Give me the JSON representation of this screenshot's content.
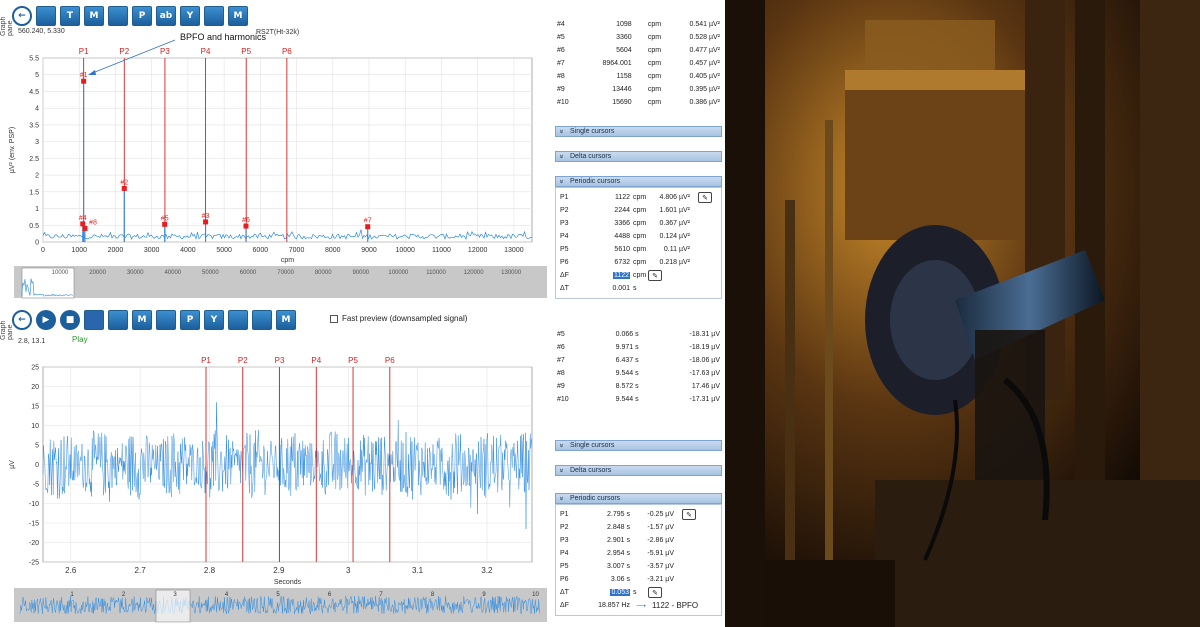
{
  "colors": {
    "accent": "#1c5f9c",
    "signal": "#2f8ce0",
    "cursor_line": "#d62020",
    "marker": "#e81e1e",
    "panel_header": "#b6cde9"
  },
  "top": {
    "graph_pane_label": "Graph pane",
    "coords": "560.240, 5.330",
    "toolbar_icons": [
      "back-arrow-icon",
      "export-icon",
      "trend-icon",
      "marker-icon",
      "harmonic-icon",
      "peak-icon",
      "ab-label-icon",
      "y-scale-icon",
      "zoom-box-icon",
      "overlay-marker-icon"
    ],
    "toolbar_labels": [
      "",
      "",
      "T",
      "M",
      "",
      "P",
      "ab",
      "Y",
      "",
      "M"
    ],
    "annotation": "BPFO and harmonics",
    "chart_title": "RS2T(Ht-32k)"
  },
  "bottom": {
    "graph_pane_label": "Graph pane",
    "coords": "2.8, 13.1",
    "toolbar_icons": [
      "back-arrow-icon",
      "play-icon",
      "stop-icon",
      "save-icon",
      "spectrum-icon",
      "marker-icon",
      "harmonic-icon",
      "peak-icon",
      "y-scale-icon",
      "eraser-icon",
      "zoom-box-icon",
      "overlay-marker-icon"
    ],
    "toolbar_labels": [
      "",
      "▶",
      "■",
      "",
      "",
      "M",
      "",
      "P",
      "Y",
      "",
      "",
      "M"
    ],
    "play_label": "Play",
    "fast_preview_label": "Fast preview (downsampled signal)"
  },
  "chart_data": [
    {
      "type": "bar",
      "title": "RS2T(Ht-32k)",
      "xlabel": "cpm",
      "ylabel": "µV² (env. PSP)",
      "xlim": [
        0,
        13500
      ],
      "ylim": [
        0,
        5.5
      ],
      "x_ticks": [
        0,
        1000,
        2000,
        3000,
        4000,
        5000,
        6000,
        7000,
        8000,
        9000,
        10000,
        11000,
        12000,
        13000
      ],
      "y_ticks": [
        0,
        0.5,
        1,
        1.5,
        2,
        2.5,
        3,
        3.5,
        4,
        4.5,
        5,
        5.5
      ],
      "cursors": [
        {
          "label": "P1",
          "x": 1122
        },
        {
          "label": "P2",
          "x": 2244
        },
        {
          "label": "P3",
          "x": 3366
        },
        {
          "label": "P4",
          "x": 4488
        },
        {
          "label": "P5",
          "x": 5610
        },
        {
          "label": "P6",
          "x": 6732
        }
      ],
      "peaks": [
        {
          "label": "#1",
          "x": 1122,
          "y": 4.806
        },
        {
          "label": "#2",
          "x": 2244,
          "y": 1.601
        },
        {
          "label": "#3",
          "x": 4488,
          "y": 0.6
        },
        {
          "label": "#4",
          "x": 1098,
          "y": 0.541
        },
        {
          "label": "#5",
          "x": 3360,
          "y": 0.528
        },
        {
          "label": "#6",
          "x": 5604,
          "y": 0.477
        },
        {
          "label": "#7",
          "x": 8964.001,
          "y": 0.457
        },
        {
          "label": "#8",
          "x": 1158,
          "y": 0.405
        }
      ],
      "overview_ticks": [
        "10000",
        "20000",
        "30000",
        "40000",
        "50000",
        "60000",
        "70000",
        "80000",
        "90000",
        "100000",
        "110000",
        "120000",
        "130000"
      ]
    },
    {
      "type": "line",
      "xlabel": "Seconds",
      "ylabel": "µV",
      "xlim": [
        2.56,
        3.265
      ],
      "ylim": [
        -25,
        25
      ],
      "x_ticks": [
        2.6,
        2.7,
        2.8,
        2.9,
        3,
        3.1,
        3.2
      ],
      "y_ticks": [
        -25,
        -20,
        -15,
        -10,
        -5,
        0,
        5,
        10,
        15,
        20,
        25
      ],
      "cursors": [
        {
          "label": "P1",
          "x": 2.795
        },
        {
          "label": "P2",
          "x": 2.848
        },
        {
          "label": "P3",
          "x": 2.901
        },
        {
          "label": "P4",
          "x": 2.954
        },
        {
          "label": "P5",
          "x": 3.007
        },
        {
          "label": "P6",
          "x": 3.06
        }
      ],
      "overview_ticks": [
        "1",
        "2",
        "3",
        "4",
        "5",
        "6",
        "7",
        "8",
        "9",
        "10"
      ]
    }
  ],
  "top_panel": {
    "peaks": [
      {
        "n": "#4",
        "f": "1098",
        "u": "cpm",
        "v": "0.541 µV²"
      },
      {
        "n": "#5",
        "f": "3360",
        "u": "cpm",
        "v": "0.528 µV²"
      },
      {
        "n": "#6",
        "f": "5604",
        "u": "cpm",
        "v": "0.477 µV²"
      },
      {
        "n": "#7",
        "f": "8964.001",
        "u": "cpm",
        "v": "0.457 µV²"
      },
      {
        "n": "#8",
        "f": "1158",
        "u": "cpm",
        "v": "0.405 µV²"
      },
      {
        "n": "#9",
        "f": "13446",
        "u": "cpm",
        "v": "0.395 µV²"
      },
      {
        "n": "#10",
        "f": "15690",
        "u": "cpm",
        "v": "0.386 µV²"
      }
    ],
    "single_cursors": "Single cursors",
    "delta_cursors": "Delta cursors",
    "periodic_cursors": "Periodic cursors",
    "periodic": [
      {
        "p": "P1",
        "f": "1122",
        "u": "cpm",
        "v": "4.806 µV²"
      },
      {
        "p": "P2",
        "f": "2244",
        "u": "cpm",
        "v": "1.601 µV²"
      },
      {
        "p": "P3",
        "f": "3366",
        "u": "cpm",
        "v": "0.367 µV²"
      },
      {
        "p": "P4",
        "f": "4488",
        "u": "cpm",
        "v": "0.124 µV²"
      },
      {
        "p": "P5",
        "f": "5610",
        "u": "cpm",
        "v": "0.11 µV²"
      },
      {
        "p": "P6",
        "f": "6732",
        "u": "cpm",
        "v": "0.218 µV²"
      }
    ],
    "delta_f_label": "ΔF",
    "delta_f_value": "1122",
    "delta_f_unit": "cpm",
    "delta_t_label": "ΔT",
    "delta_t_value": "0.001",
    "delta_t_unit": "s"
  },
  "bottom_panel": {
    "peaks": [
      {
        "n": "#5",
        "t": "0.066 s",
        "v": "-18.31 µV"
      },
      {
        "n": "#6",
        "t": "9.971 s",
        "v": "-18.19 µV"
      },
      {
        "n": "#7",
        "t": "6.437 s",
        "v": "-18.06 µV"
      },
      {
        "n": "#8",
        "t": "9.544 s",
        "v": "-17.63 µV"
      },
      {
        "n": "#9",
        "t": "8.572 s",
        "v": "17.46 µV"
      },
      {
        "n": "#10",
        "t": "9.544 s",
        "v": "-17.31 µV"
      }
    ],
    "single_cursors": "Single cursors",
    "delta_cursors": "Delta cursors",
    "periodic_cursors": "Periodic cursors",
    "periodic": [
      {
        "p": "P1",
        "t": "2.795 s",
        "v": "-0.25 µV"
      },
      {
        "p": "P2",
        "t": "2.848 s",
        "v": "-1.57 µV"
      },
      {
        "p": "P3",
        "t": "2.901 s",
        "v": "-2.86 µV"
      },
      {
        "p": "P4",
        "t": "2.954 s",
        "v": "-5.91 µV"
      },
      {
        "p": "P5",
        "t": "3.007 s",
        "v": "-3.57 µV"
      },
      {
        "p": "P6",
        "t": "3.06 s",
        "v": "-3.21 µV"
      }
    ],
    "delta_t_label": "ΔT",
    "delta_t_value": "0.053",
    "delta_t_unit": "s",
    "delta_f_label": "ΔF",
    "delta_f_value": "18.857 Hz",
    "bpfo_note": "1122 - BPFO"
  }
}
